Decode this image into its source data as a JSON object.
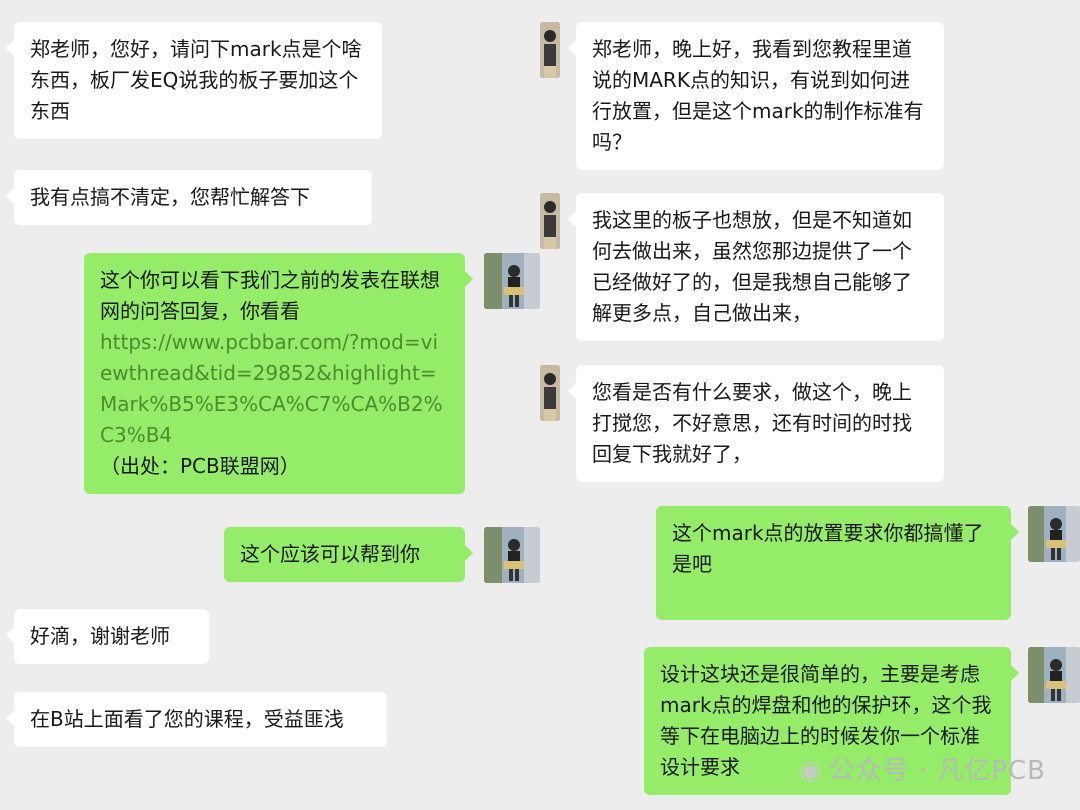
{
  "left_chat": {
    "messages": [
      {
        "text": "郑老师，您好，请问下mark点是个啥东西，板厂发EQ说我的板子要加这个东西"
      },
      {
        "text": "我有点搞不清定，您帮忙解答下"
      },
      {
        "text_a": "这个你可以看下我们之前的发表在联想网的问答回复，你看看",
        "link": "https://www.pcbbar.com/?mod=viewthread&tid=29852&highlight=Mark%B5%E3%CA%C7%CA%B2%C3%B4",
        "text_b": "（出处：PCB联盟网）"
      },
      {
        "text": "这个应该可以帮到你"
      },
      {
        "text": "好滴，谢谢老师"
      },
      {
        "text": "在B站上面看了您的课程，受益匪浅"
      }
    ]
  },
  "right_chat": {
    "messages": [
      {
        "text": "郑老师，晚上好，我看到您教程里道说的MARK点的知识，有说到如何进行放置，但是这个mark的制作标准有吗？"
      },
      {
        "text": "我这里的板子也想放，但是不知道如何去做出来，虽然您那边提供了一个已经做好了的，但是我想自己能够了解更多点，自己做出来，"
      },
      {
        "text": "您看是否有什么要求，做这个，晚上打搅您，不好意思，还有时间的时找回复下我就好了，"
      },
      {
        "text": "这个mark点的放置要求你都搞懂了是吧"
      },
      {
        "text": "设计这块还是很简单的，主要是考虑mark点的焊盘和他的保护环，这个我等下在电脑边上的时候发你一个标准设计要求"
      }
    ]
  },
  "watermark": {
    "icon": "wechat-icon",
    "text": "公众号 · 凡亿PCB"
  },
  "colors": {
    "background": "#ededed",
    "incoming": "#ffffff",
    "outgoing": "#95ec69",
    "link": "#4b8c2e"
  }
}
